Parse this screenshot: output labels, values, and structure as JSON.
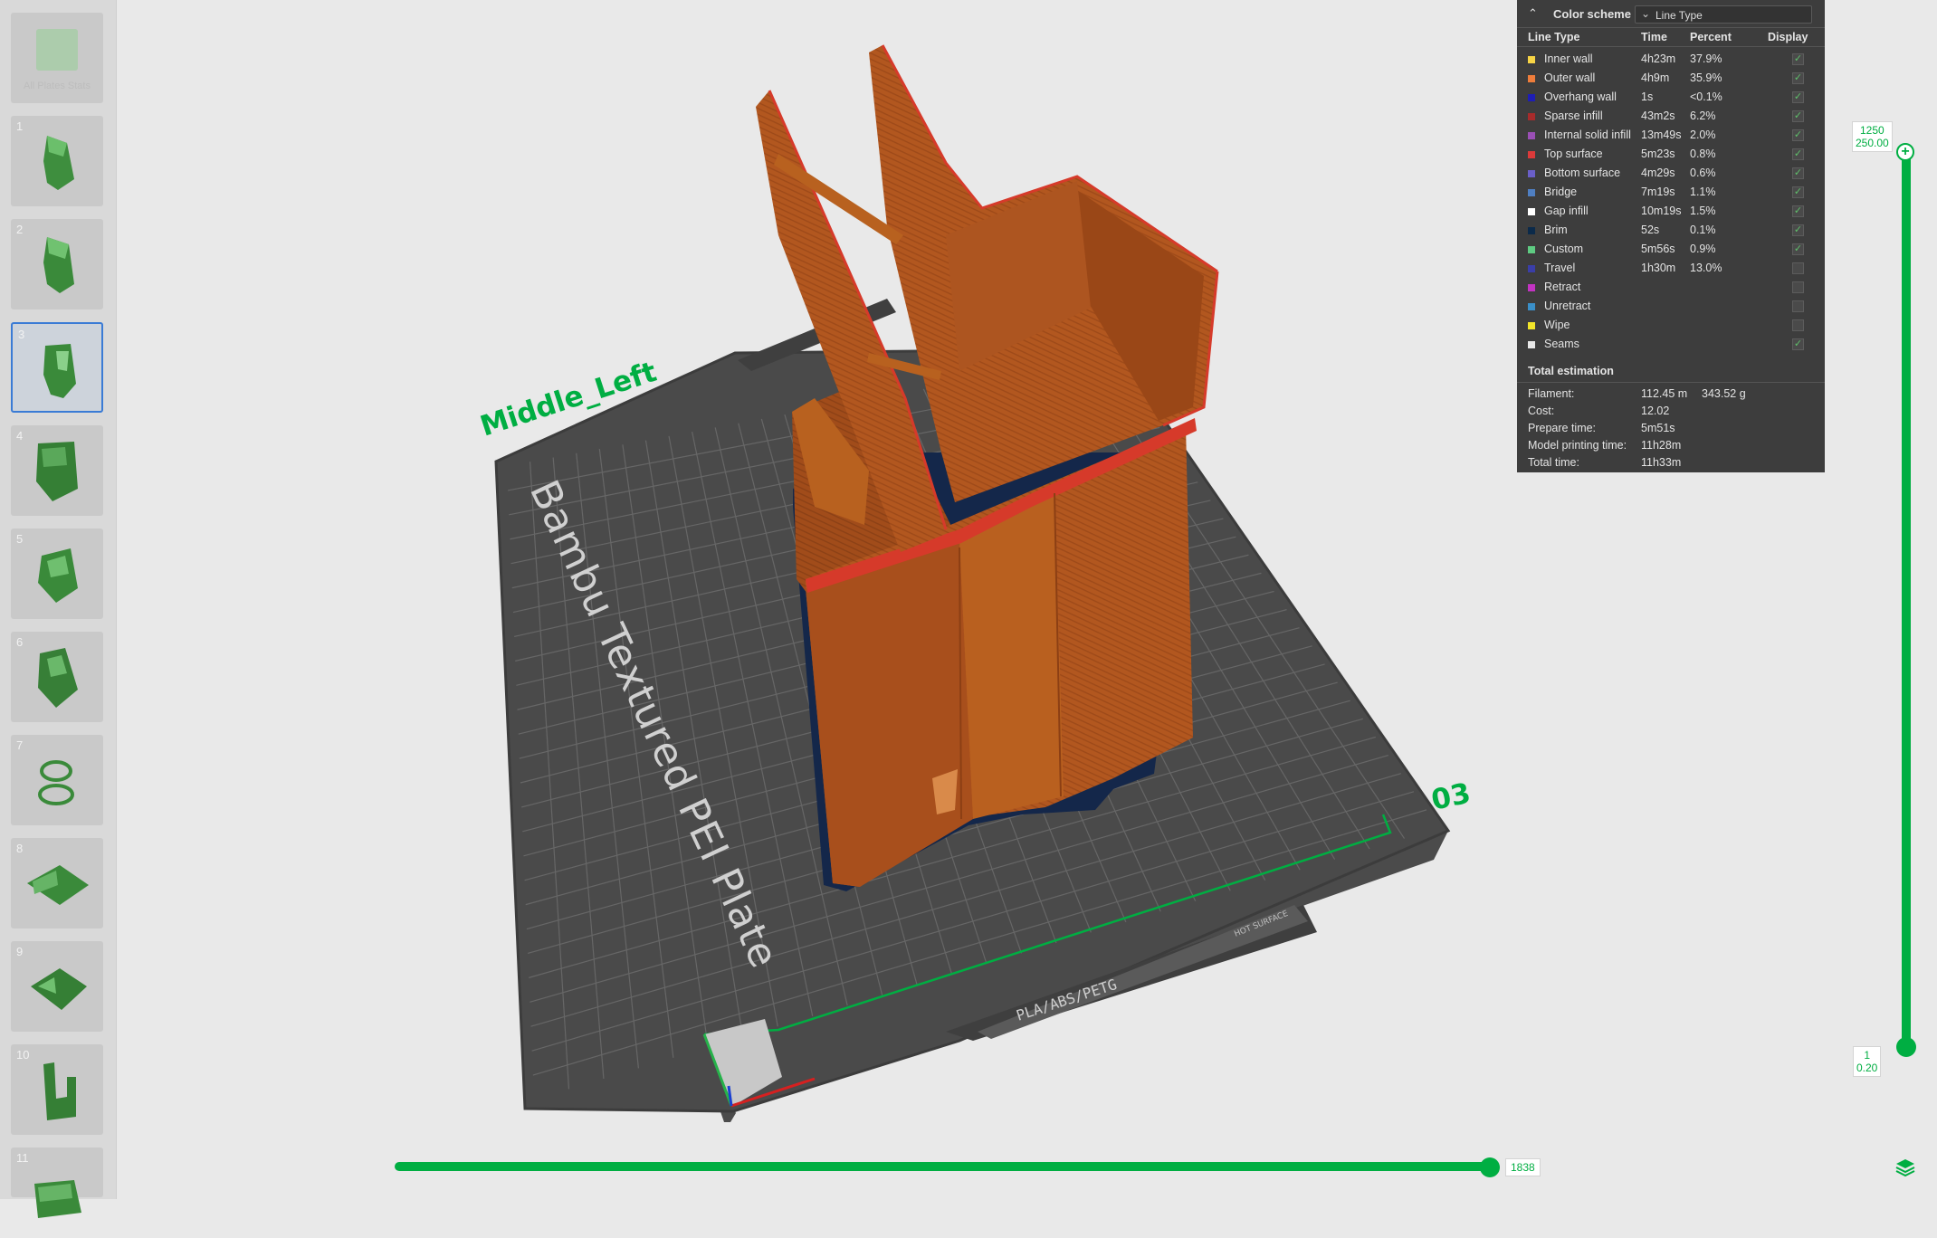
{
  "plates": {
    "items": [
      {
        "num": "",
        "caption": "All Plates Stats"
      },
      {
        "num": "1",
        "caption": ""
      },
      {
        "num": "2",
        "caption": ""
      },
      {
        "num": "3",
        "caption": ""
      },
      {
        "num": "4",
        "caption": ""
      },
      {
        "num": "5",
        "caption": ""
      },
      {
        "num": "6",
        "caption": ""
      },
      {
        "num": "7",
        "caption": ""
      },
      {
        "num": "8",
        "caption": ""
      },
      {
        "num": "9",
        "caption": ""
      },
      {
        "num": "10",
        "caption": ""
      },
      {
        "num": "11",
        "caption": ""
      }
    ],
    "selected": "3"
  },
  "scene": {
    "plate_name": "Middle_Left",
    "plate_number": "03",
    "bed_text": "Bambu Textured PEI Plate",
    "bed_material": "PLA/ABS/PETG",
    "bed_surface": "HOT SURFACE",
    "colors": {
      "bed": "#4b4b4b",
      "grid": "#5d5d5d",
      "model": "#b2571f",
      "accent": "#00ae42",
      "brim": "#14274a"
    }
  },
  "legend": {
    "title": "Color scheme",
    "scheme_value": "Line Type",
    "columns": [
      "Line Type",
      "Time",
      "Percent",
      "Display"
    ],
    "rows": [
      {
        "name": "Inner wall",
        "time": "4h23m",
        "percent": "37.9%",
        "color": "#f7d445",
        "checked": true
      },
      {
        "name": "Outer wall",
        "time": "4h9m",
        "percent": "35.9%",
        "color": "#ee7d3b",
        "checked": true
      },
      {
        "name": "Overhang wall",
        "time": "1s",
        "percent": "<0.1%",
        "color": "#1e1eb5",
        "checked": true
      },
      {
        "name": "Sparse infill",
        "time": "43m2s",
        "percent": "6.2%",
        "color": "#a62b2b",
        "checked": true
      },
      {
        "name": "Internal solid infill",
        "time": "13m49s",
        "percent": "2.0%",
        "color": "#9a4fb5",
        "checked": true
      },
      {
        "name": "Top surface",
        "time": "5m23s",
        "percent": "0.8%",
        "color": "#dc3a3a",
        "checked": true
      },
      {
        "name": "Bottom surface",
        "time": "4m29s",
        "percent": "0.6%",
        "color": "#6a5fc8",
        "checked": true
      },
      {
        "name": "Bridge",
        "time": "7m19s",
        "percent": "1.1%",
        "color": "#4f7fc2",
        "checked": true
      },
      {
        "name": "Gap infill",
        "time": "10m19s",
        "percent": "1.5%",
        "color": "#ffffff",
        "checked": true
      },
      {
        "name": "Brim",
        "time": "52s",
        "percent": "0.1%",
        "color": "#0b2a4a",
        "checked": true
      },
      {
        "name": "Custom",
        "time": "5m56s",
        "percent": "0.9%",
        "color": "#5ecb82",
        "checked": true
      },
      {
        "name": "Travel",
        "time": "1h30m",
        "percent": "13.0%",
        "color": "#3a3ea8",
        "checked": false
      },
      {
        "name": "Retract",
        "time": "",
        "percent": "",
        "color": "#c233c2",
        "checked": false
      },
      {
        "name": "Unretract",
        "time": "",
        "percent": "",
        "color": "#3a8fc8",
        "checked": false
      },
      {
        "name": "Wipe",
        "time": "",
        "percent": "",
        "color": "#f2e52a",
        "checked": false
      },
      {
        "name": "Seams",
        "time": "",
        "percent": "",
        "color": "#e8e8e8",
        "checked": true
      }
    ],
    "total_title": "Total estimation",
    "totals": [
      {
        "label": "Filament:",
        "value": "112.45 m",
        "value2": "343.52 g"
      },
      {
        "label": "Cost:",
        "value": "12.02",
        "value2": ""
      },
      {
        "label": "Prepare time:",
        "value": "5m51s",
        "value2": ""
      },
      {
        "label": "Model printing time:",
        "value": "11h28m",
        "value2": ""
      },
      {
        "label": "Total time:",
        "value": "11h33m",
        "value2": ""
      }
    ]
  },
  "layer_slider": {
    "top_layer": "1250",
    "top_height": "250.00",
    "bottom_layer": "1",
    "bottom_height": "0.20",
    "top_button": "+"
  },
  "move_slider": {
    "value": "1838"
  }
}
